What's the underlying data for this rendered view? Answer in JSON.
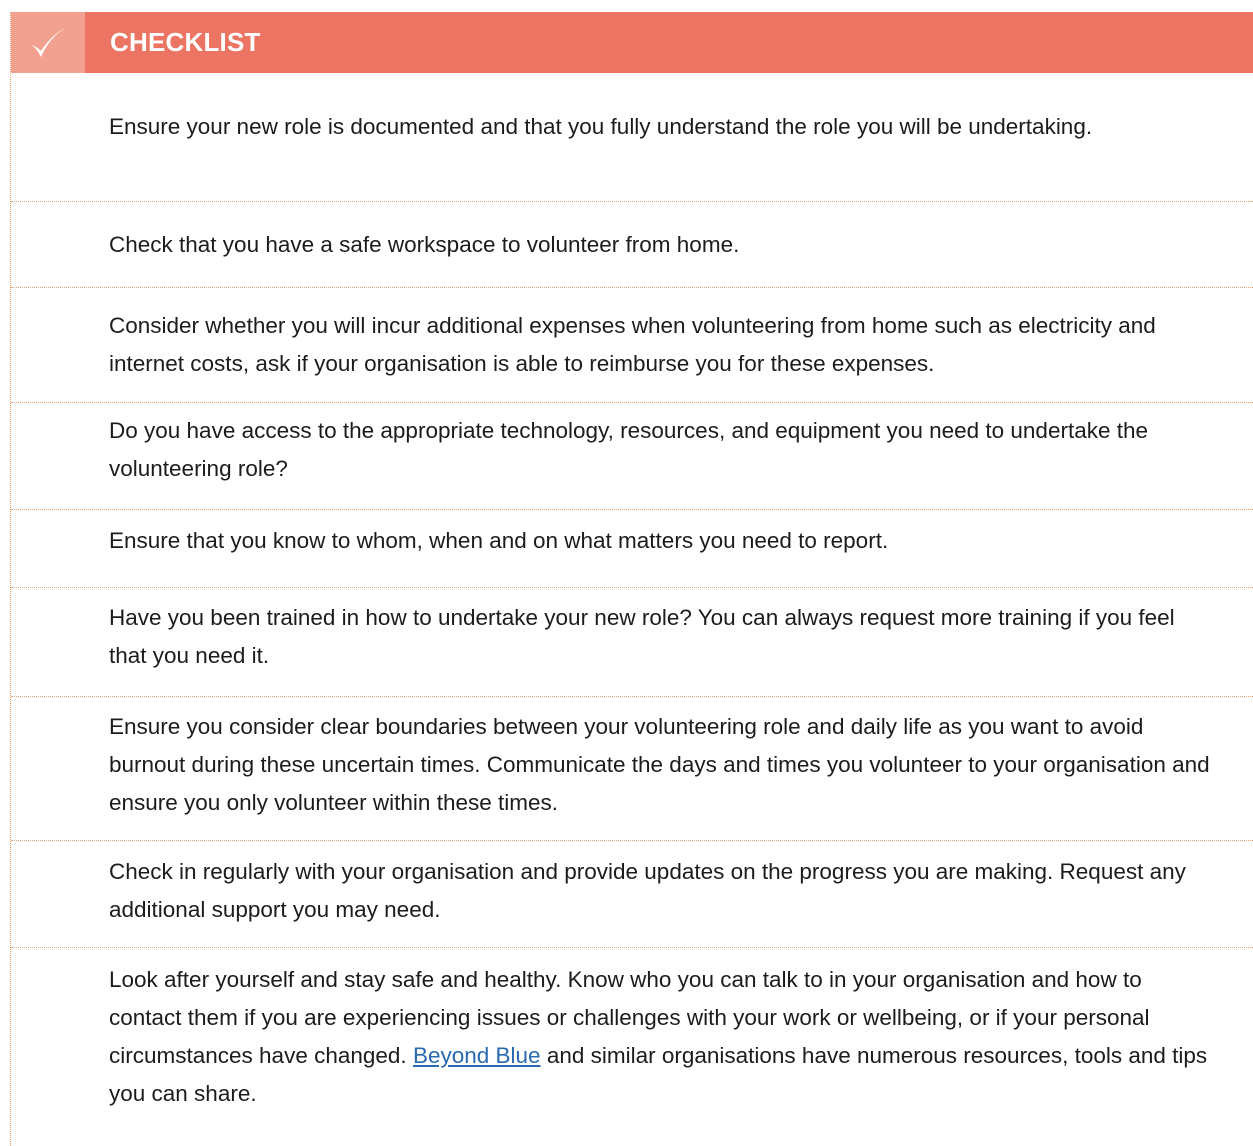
{
  "header": {
    "icon": "check-mark-icon",
    "title": "CHECKLIST",
    "colors": {
      "header_bg": "#eb7462",
      "icon_bg": "#f2a08f",
      "divider": "#e0a070",
      "link": "#2a6ab0"
    }
  },
  "items": [
    {
      "text": "Ensure your new role is documented and that you fully understand the role you will be undertaking."
    },
    {
      "text": "Check that you have a safe workspace to volunteer from home."
    },
    {
      "text": "Consider whether you will incur additional expenses when volunteering from home such as electricity and internet costs, ask if your organisation is able to reimburse you for these expenses."
    },
    {
      "text": "Do you have access to the appropriate technology, resources, and equipment you need to undertake the volunteering role?"
    },
    {
      "text": "Ensure that you know to whom, when and on what matters you need to report."
    },
    {
      "text": "Have you been trained in how to undertake your new role? You can always request more training if you feel that you need it."
    },
    {
      "text": "Ensure you consider clear boundaries between your volunteering role and daily life as you want to avoid burnout during these uncertain times. Communicate the days and times you volunteer to your organisation and ensure you only volunteer within these times."
    },
    {
      "text": "Check in regularly with your organisation and provide updates on the progress you are making. Request any additional support you may need."
    },
    {
      "text_before": "Look after yourself and stay safe and healthy. Know who you can talk to in your organisation and how to contact them if you are experiencing issues or challenges with your work or wellbeing, or if your personal circumstances have changed.",
      "link_text": "Beyond Blue",
      "text_after": "and similar organisations have numerous resources, tools and tips you can share."
    }
  ]
}
